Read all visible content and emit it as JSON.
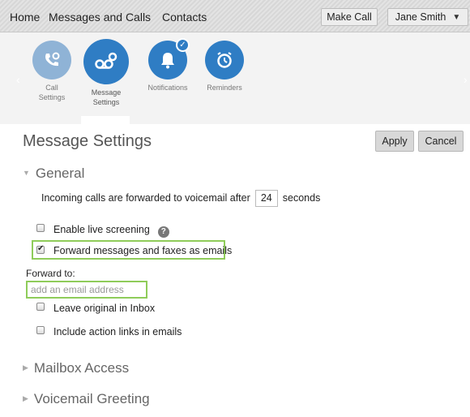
{
  "nav": {
    "home": "Home",
    "messages": "Messages and Calls",
    "contacts": "Contacts",
    "make_call": "Make Call",
    "user": "Jane Smith"
  },
  "icons": {
    "call_settings": {
      "line1": "Call",
      "line2": "Settings"
    },
    "message_settings": {
      "line1": "Message",
      "line2": "Settings"
    },
    "notifications": "Notifications",
    "reminders": "Reminders"
  },
  "page": {
    "title": "Message Settings",
    "apply": "Apply",
    "cancel": "Cancel"
  },
  "general": {
    "heading": "General",
    "forward_prefix": "Incoming calls are forwarded to voicemail after",
    "forward_seconds": "24",
    "forward_suffix": "seconds",
    "live_screening": "Enable live screening",
    "forward_emails": "Forward messages and faxes as emails",
    "forward_to": "Forward to:",
    "email_placeholder": "add an email address",
    "leave_original": "Leave original in Inbox",
    "include_links": "Include action links in emails"
  },
  "sections": {
    "mailbox": "Mailbox Access",
    "greeting": "Voicemail Greeting"
  },
  "state": {
    "live_screening_checked": false,
    "forward_emails_checked": true,
    "leave_original_checked": false,
    "include_links_checked": false
  },
  "colors": {
    "accent": "#2f7dc4",
    "highlight": "#8fcc5a"
  }
}
